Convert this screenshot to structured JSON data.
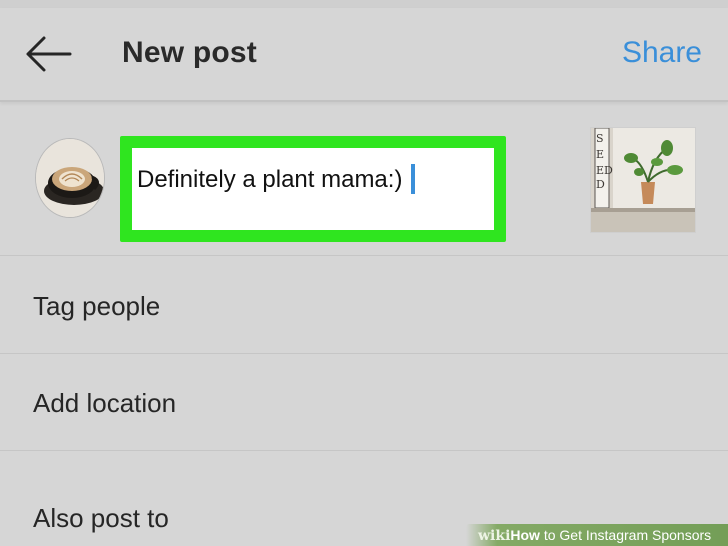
{
  "header": {
    "title": "New post",
    "share_label": "Share"
  },
  "compose": {
    "caption_value": "Definitely a plant mama:)"
  },
  "options": [
    {
      "label": "Tag people"
    },
    {
      "label": "Add location"
    },
    {
      "label": "Also post to"
    }
  ],
  "watermark": {
    "brand": "wiki",
    "how": "How",
    "rest": " to Get Instagram Sponsors"
  },
  "colors": {
    "accent": "#3a8fd9",
    "highlight": "#2fe51f",
    "background": "#d6d6d6"
  },
  "icons": {
    "back": "arrow-left-icon"
  }
}
